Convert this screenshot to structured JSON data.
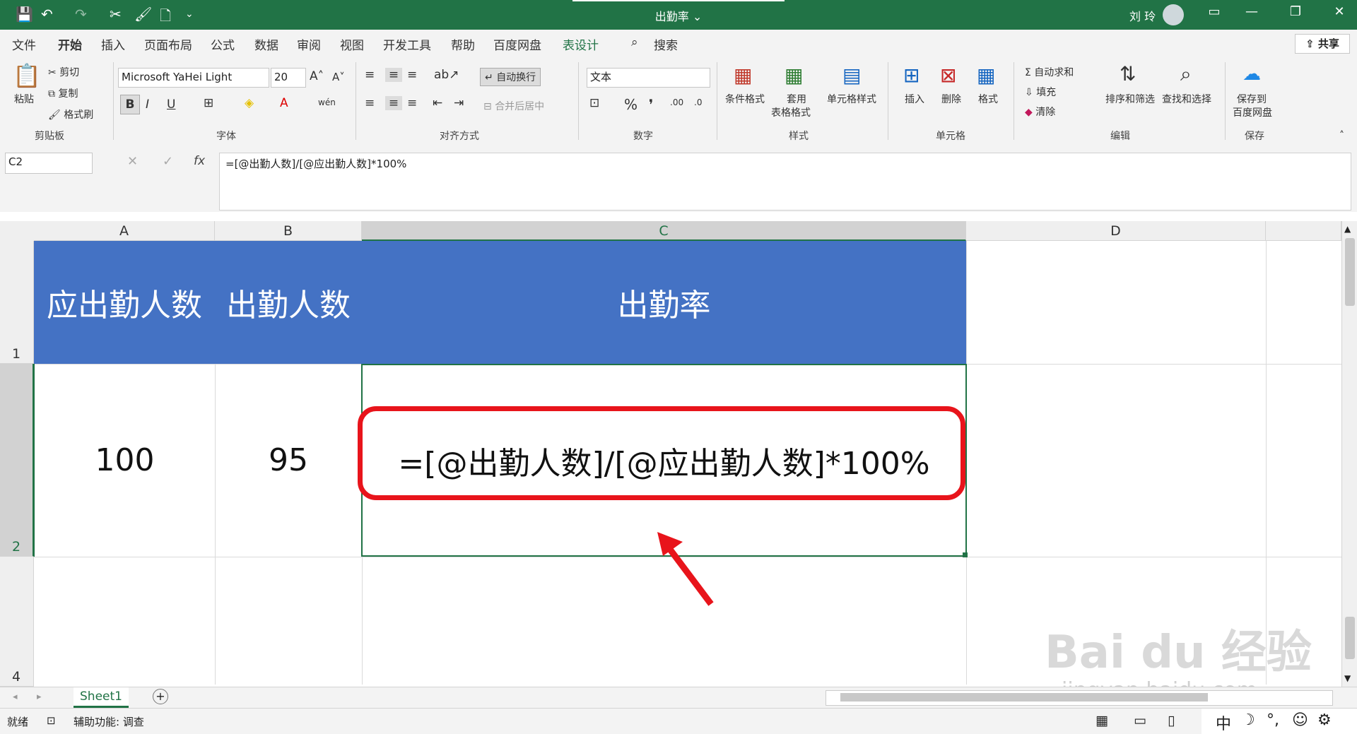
{
  "titlebar": {
    "title": "出勤率 ⌄",
    "user": "刘 玲",
    "quick_access": [
      "💾",
      "↶",
      "↷",
      "✂",
      "🖌",
      "🗋",
      "⌄"
    ],
    "window_buttons": [
      "▭",
      "—",
      "❐",
      "✕"
    ]
  },
  "menu": {
    "tabs": [
      "文件",
      "开始",
      "插入",
      "页面布局",
      "公式",
      "数据",
      "审阅",
      "视图",
      "开发工具",
      "帮助",
      "百度网盘",
      "表设计"
    ],
    "search": "搜索",
    "share": "共享"
  },
  "ribbon": {
    "clipboard": {
      "paste": "粘贴",
      "cut": "剪切",
      "copy": "复制",
      "format_painter": "格式刷",
      "group": "剪贴板"
    },
    "font": {
      "name": "Microsoft YaHei Light",
      "size": "20",
      "group": "字体",
      "bold": "B",
      "italic": "I",
      "underline": "U"
    },
    "alignment": {
      "wrap": "自动换行",
      "merge": "合并后居中",
      "group": "对齐方式"
    },
    "number": {
      "format": "文本",
      "group": "数字"
    },
    "styles": {
      "conditional": "条件格式",
      "table1": "套用",
      "table2": "表格格式",
      "cell_styles": "单元格样式",
      "group": "样式"
    },
    "cells": {
      "insert": "插入",
      "delete": "删除",
      "format": "格式",
      "group": "单元格"
    },
    "editing": {
      "autosum": "自动求和",
      "fill": "填充",
      "clear": "清除",
      "sort": "排序和筛选",
      "find": "查找和选择",
      "group": "编辑"
    },
    "save": {
      "line1": "保存到",
      "line2": "百度网盘",
      "group": "保存"
    }
  },
  "formula_bar": {
    "name_box": "C2",
    "fx": "fx",
    "formula": "=[@出勤人数]/[@应出勤人数]*100%"
  },
  "grid": {
    "columns": [
      "A",
      "B",
      "C",
      "D"
    ],
    "rows": [
      "1",
      "2",
      "4"
    ],
    "header": [
      "应出勤人数",
      "出勤人数",
      "出勤率"
    ],
    "row2": [
      "100",
      "95",
      "=[@出勤人数]/[@应出勤人数]*100%"
    ]
  },
  "sheets": {
    "active": "Sheet1",
    "add": "+"
  },
  "status": {
    "ready": "就绪",
    "accessibility": "辅助功能: 调查",
    "ime": [
      "中",
      "☽",
      "°,",
      "☺",
      "⚙"
    ]
  },
  "watermark": {
    "brand": "Bai du 经验",
    "url": "jingyan.baidu.com"
  },
  "colors": {
    "excel_green": "#217346",
    "header_fill": "#4472c4",
    "highlight_red": "#e8141b"
  }
}
